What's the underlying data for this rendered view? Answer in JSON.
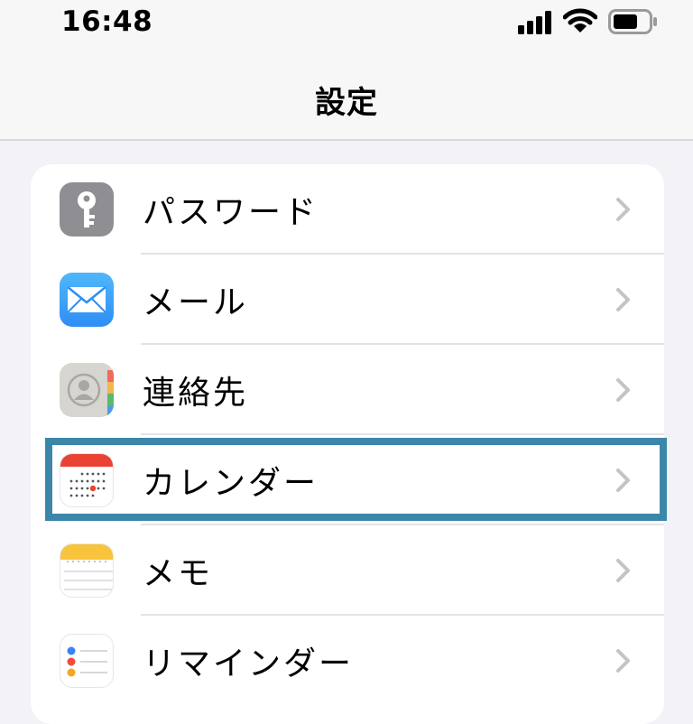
{
  "status_bar": {
    "time": "16:48",
    "icons": [
      "signal-icon",
      "wifi-icon",
      "battery-icon"
    ]
  },
  "nav": {
    "title": "設定"
  },
  "settings": {
    "items": [
      {
        "label": "パスワード",
        "icon": "key-icon",
        "color": "#8e8e93"
      },
      {
        "label": "メール",
        "icon": "mail-icon",
        "color": "#2f8df5"
      },
      {
        "label": "連絡先",
        "icon": "contacts-icon",
        "color": "#d7d5cf"
      },
      {
        "label": "カレンダー",
        "icon": "calendar-icon",
        "color": "#ea4335"
      },
      {
        "label": "メモ",
        "icon": "notes-icon",
        "color": "#f7c43c"
      },
      {
        "label": "リマインダー",
        "icon": "reminders-icon",
        "color": "#ffffff"
      }
    ]
  },
  "highlight": {
    "target": "カレンダー",
    "color": "#3c87a9"
  }
}
